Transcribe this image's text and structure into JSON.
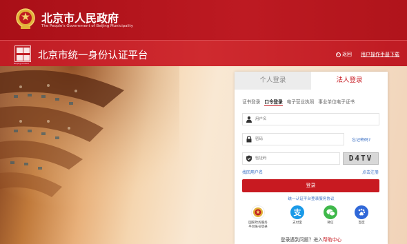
{
  "header": {
    "gov_title": "北京市人民政府",
    "gov_subtitle": "The People's Government of Beijing Municipality"
  },
  "subheader": {
    "platform_title": "北京市统一身份认证平台",
    "logo_caption": "Beijing Unified",
    "back_label": "返回",
    "manual_label": "用户操作手册下载"
  },
  "login": {
    "tabs": [
      {
        "label": "个人登录",
        "active": false
      },
      {
        "label": "法人登录",
        "active": true
      }
    ],
    "subtabs": [
      {
        "label": "证书登录",
        "active": false
      },
      {
        "label": "口令登录",
        "active": true
      },
      {
        "label": "电子营业执照",
        "active": false
      },
      {
        "label": "事业单位电子证书",
        "active": false
      }
    ],
    "username_placeholder": "用户名",
    "password_placeholder": "密码",
    "forgot_password": "忘记密码?",
    "captcha_placeholder": "验证码",
    "captcha_text": "D4TV",
    "retrieve_username": "找回用户名",
    "register": "点击注册",
    "login_button": "登录",
    "agreement": "统一认证平台登录服务协议",
    "oauth": [
      {
        "label_line1": "国家政务服务",
        "label_line2": "平台账号登录",
        "icon": "national-emblem-icon",
        "color": "#ffffff"
      },
      {
        "label_line1": "支付宝",
        "label_line2": "",
        "icon": "alipay-icon",
        "color": "#1a9ae8"
      },
      {
        "label_line1": "微信",
        "label_line2": "",
        "icon": "wechat-icon",
        "color": "#3fb84a"
      },
      {
        "label_line1": "百度",
        "label_line2": "",
        "icon": "baidu-icon",
        "color": "#3068d8"
      }
    ],
    "help_prefix": "登录遇到问题？进入",
    "help_link": "帮助中心"
  },
  "colors": {
    "brand_red": "#c81a21",
    "header_red": "#b5141c",
    "link_blue": "#3a6fc4"
  }
}
